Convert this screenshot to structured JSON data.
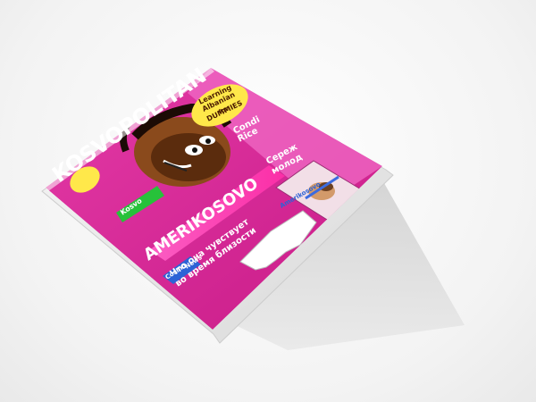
{
  "magazine": {
    "masthead": "KOSVOPOLITAN",
    "badge_line1": "Learning",
    "badge_line2": "Albanian",
    "badge_line3": "for",
    "badge_line4": "DUMMIES",
    "cover_name": "Condi",
    "cover_name2": "Rice",
    "side_headline": "Сереж",
    "side_headline2": "молод",
    "main_title": "AMERIKOSOVO",
    "headline_1": "Что она чувствует",
    "headline_2": "во время близости",
    "left_tag": "Kosvo",
    "bottom_tag": "Cosmo",
    "bottom_tag2": "News",
    "spread_label": "Amerikosovo",
    "colors": {
      "cover_magenta": "#e02a9a",
      "cover_pink": "#ff3fb6",
      "masthead_white": "#ffffff",
      "accent_yellow": "#ffe84a",
      "accent_green": "#27c23a",
      "accent_blue": "#2c63d6",
      "shadow": "#bfbfbf"
    }
  }
}
